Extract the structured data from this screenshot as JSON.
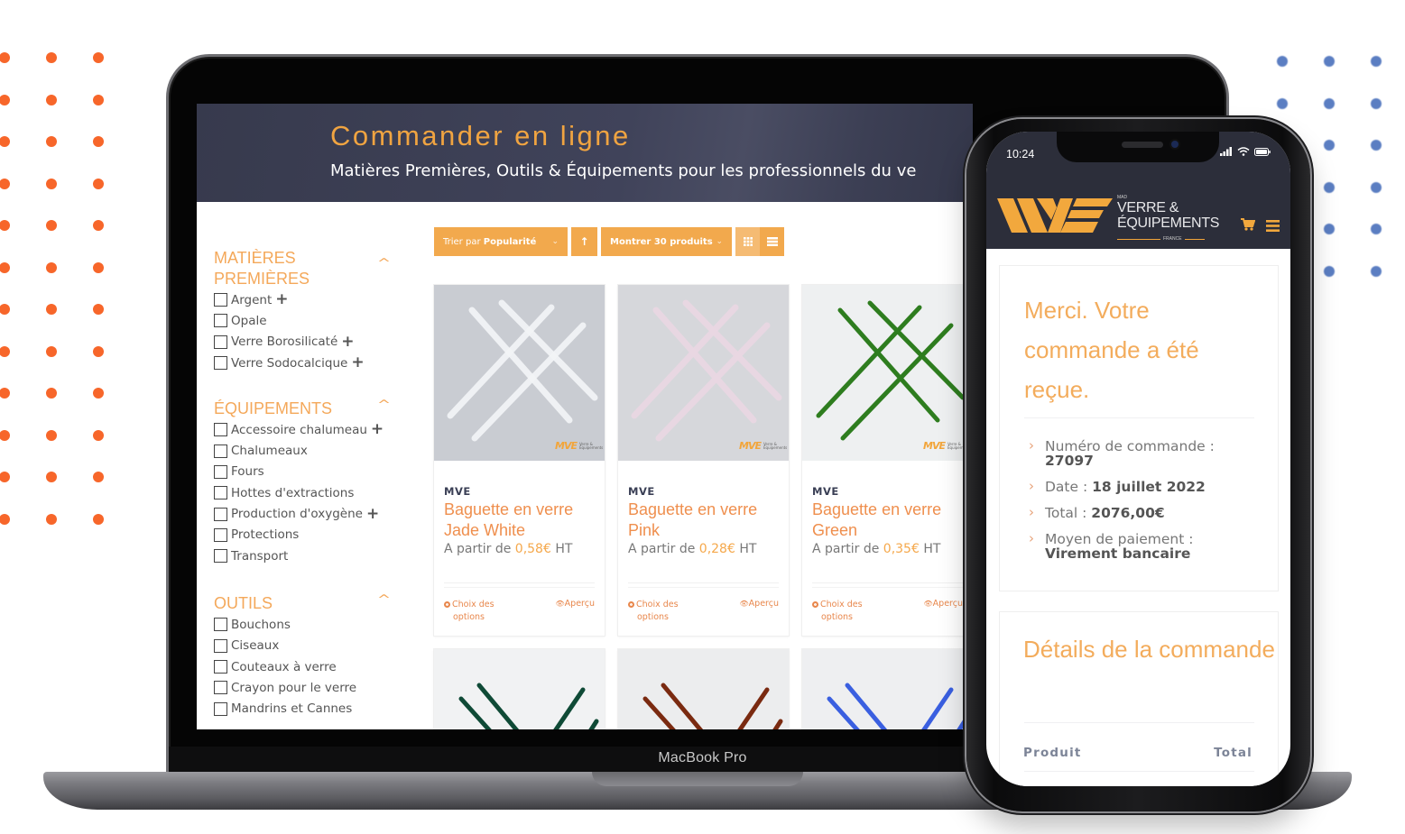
{
  "device_labels": {
    "laptop": "MacBook Pro"
  },
  "colors": {
    "accent_orange": "#f0a441",
    "dot_orange": "#f7662a",
    "dot_blue": "#5b7ec2",
    "hero_bg": "#3d4055",
    "toolbar_bg": "#f2a94d",
    "product_title": "#ef8f4e"
  },
  "site": {
    "hero": {
      "title": "Commander en ligne",
      "subtitle": "Matières Premières, Outils & Équipements pour les professionnels du ve"
    },
    "sidebar": {
      "categories": [
        {
          "title": "MATIÈRES PREMIÈRES",
          "items": [
            {
              "label": "Argent",
              "expandable": true
            },
            {
              "label": "Opale",
              "expandable": false
            },
            {
              "label": "Verre Borosilicaté",
              "expandable": true
            },
            {
              "label": "Verre Sodocalcique",
              "expandable": true
            }
          ]
        },
        {
          "title": "ÉQUIPEMENTS",
          "items": [
            {
              "label": "Accessoire chalumeau",
              "expandable": true
            },
            {
              "label": "Chalumeaux",
              "expandable": false
            },
            {
              "label": "Fours",
              "expandable": false
            },
            {
              "label": "Hottes d'extractions",
              "expandable": false
            },
            {
              "label": "Production d'oxygène",
              "expandable": true
            },
            {
              "label": "Protections",
              "expandable": false
            },
            {
              "label": "Transport",
              "expandable": false
            }
          ]
        },
        {
          "title": "OUTILS",
          "items": [
            {
              "label": "Bouchons",
              "expandable": false
            },
            {
              "label": "Ciseaux",
              "expandable": false
            },
            {
              "label": "Couteaux à verre",
              "expandable": false
            },
            {
              "label": "Crayon pour le verre",
              "expandable": false
            },
            {
              "label": "Mandrins et Cannes",
              "expandable": false
            }
          ]
        }
      ]
    },
    "toolbar": {
      "sort_prefix": "Trier par ",
      "sort_value": "Popularité",
      "sort_direction_icon": "arrow-up-icon",
      "show_label": "Montrer 30 produits",
      "view_modes": [
        "grid-icon",
        "list-icon"
      ],
      "active_view": "grid"
    },
    "products": [
      {
        "brand": "MVE",
        "name": "Baguette en verre Jade White",
        "price_prefix": "A partir de ",
        "price": "0,58€",
        "price_suffix": " HT",
        "options_label_1": "Choix des",
        "options_label_2": "options",
        "preview_label": "Aperçu",
        "rod_color": "#f3f5f7",
        "bg": "#c9ccd2"
      },
      {
        "brand": "MVE",
        "name": "Baguette en verre Pink",
        "price_prefix": "A partir de ",
        "price": "0,28€",
        "price_suffix": " HT",
        "options_label_1": "Choix des",
        "options_label_2": "options",
        "preview_label": "Aperçu",
        "rod_color": "#ead7e3",
        "bg": "#d6d7db"
      },
      {
        "brand": "MVE",
        "name": "Baguette en verre Green",
        "price_prefix": "A partir de ",
        "price": "0,35€",
        "price_suffix": " HT",
        "options_label_1": "Choix des",
        "options_label_2": "options",
        "preview_label": "Aperçu",
        "rod_color": "#2e7d1f",
        "bg": "#eef0f1"
      },
      {
        "rod_color": "#0f4a36",
        "bg": "#f1f2f3"
      },
      {
        "rod_color": "#7a2a10",
        "bg": "#ecedee"
      },
      {
        "rod_color": "#3a5fe0",
        "bg": "#eeeff1"
      }
    ],
    "watermark": {
      "mark": "MVE",
      "text": "Verre & Équipements"
    }
  },
  "phone": {
    "status": {
      "time": "10:24"
    },
    "logo": {
      "mad": "MAD",
      "line1": "VERRE &",
      "line2": "ÉQUIPEMENTS",
      "country": "FRANCE"
    },
    "confirmation": {
      "title": "Merci. Votre commande a été reçue.",
      "items": [
        {
          "label": "Numéro de commande : ",
          "value": "27097"
        },
        {
          "label": "Date : ",
          "value": "18 juillet 2022"
        },
        {
          "label": "Total : ",
          "value": "2076,00€"
        },
        {
          "label": "Moyen de paiement : ",
          "value": "Virement bancaire"
        }
      ]
    },
    "details": {
      "title": "Détails de la commande",
      "col_product": "Produit",
      "col_total": "Total"
    }
  }
}
